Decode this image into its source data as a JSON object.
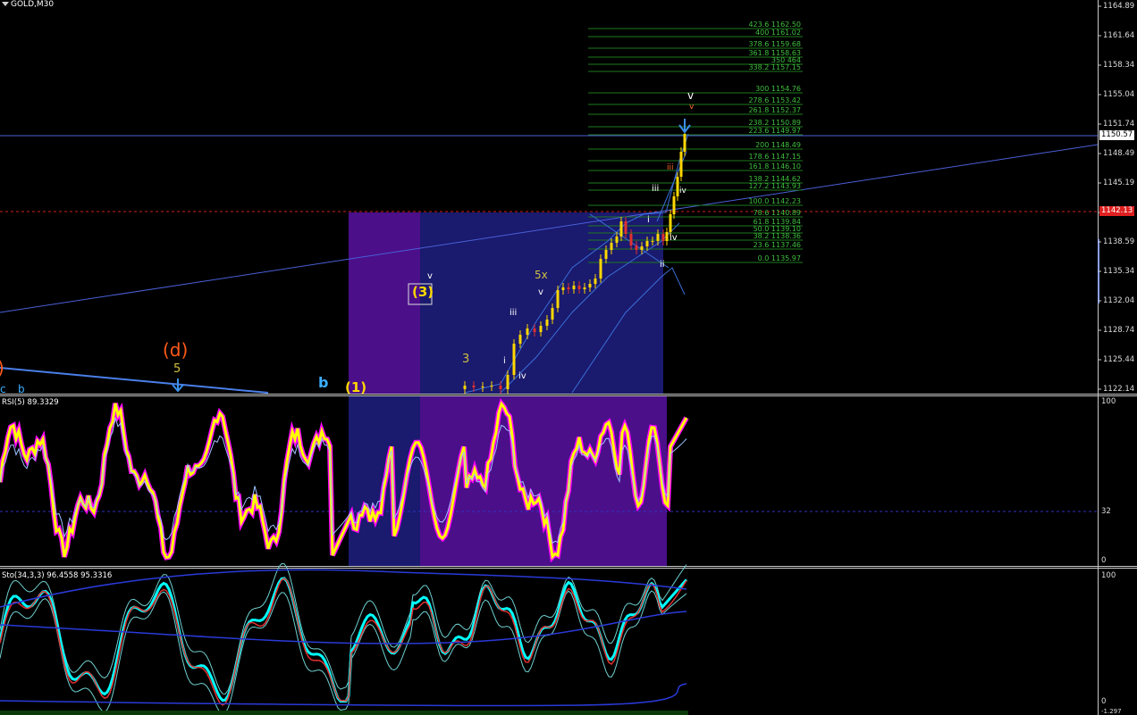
{
  "window": {
    "title": "GOLD,M30"
  },
  "price_axis": {
    "ticks": [
      "1164.89",
      "1161.64",
      "1158.34",
      "1155.04",
      "1151.74",
      "1148.49",
      "1145.19",
      "1141.89",
      "1138.59",
      "1135.34",
      "1132.04",
      "1128.74",
      "1125.44",
      "1122.14"
    ],
    "current_price": "1150.57",
    "alert_price": "1142.13"
  },
  "fib_levels": [
    {
      "label": "423.6 1162.50"
    },
    {
      "label": "400 1161.02"
    },
    {
      "label": "378.6 1159.68"
    },
    {
      "label": "361.8 1158.63"
    },
    {
      "label": "350 464"
    },
    {
      "label": "338.2 1157.15"
    },
    {
      "label": "300 1154.76"
    },
    {
      "label": "278.6 1153.42"
    },
    {
      "label": "261.8 1152.37"
    },
    {
      "label": "238.2 1150.89"
    },
    {
      "label": "223.6 1149.97"
    },
    {
      "label": "200 1148.49"
    },
    {
      "label": "178.6 1147.15"
    },
    {
      "label": "161.8 1146.10"
    },
    {
      "label": "138.2 1144.62"
    },
    {
      "label": "127.2 1143.93"
    },
    {
      "label": "100.0 1142.23"
    },
    {
      "label": "78.6 1140.89"
    },
    {
      "label": "61.8 1139.84"
    },
    {
      "label": "50.0 1139.10"
    },
    {
      "label": "38.2 1138.36"
    },
    {
      "label": "23.6 1137.46"
    },
    {
      "label": "0.0 1135.97"
    }
  ],
  "wave_labels": {
    "w3_box": "(3)",
    "v_small": "v",
    "five_x": "5x",
    "v_mid": "v",
    "iii_a": "iii",
    "i_a": "i",
    "three": "3",
    "iv_a": "iv",
    "d_label": "(d)",
    "five_d": "5",
    "b_label": "b",
    "one_paren": "(1)",
    "b_paren": ")",
    "c_label": "c",
    "b_small": "b",
    "v_top": "v",
    "v_top_small": "v",
    "iii_red": "iii",
    "iii_b": "iii",
    "iv_b": "iv",
    "i_b": "i",
    "iv_c": "iv",
    "ii_b": "ii"
  },
  "rsi": {
    "title": "RSI(5) 89.3329",
    "ticks": [
      "100",
      "32",
      "0"
    ]
  },
  "stoch": {
    "title": "Sto(34,3,3) 96.4558 95.3316",
    "ticks": [
      "100",
      "0"
    ],
    "bottom_tick": "-1.297"
  },
  "colors": {
    "bg": "#000000",
    "grid_line": "#ffffff",
    "trend": "#4a5fd8",
    "fib": "#1e8a1e",
    "fib_text": "#3fbf3f",
    "box_purple": "#4b0f8a",
    "box_navy": "#1a1a6e",
    "bull": "#ffd700",
    "bear": "#e03030",
    "rsi": "#ffff00",
    "rsi_glow": "#ff00ff",
    "stoch_main": "#00ffff",
    "stoch_signal": "#e03030",
    "alert": "#ff2020"
  }
}
